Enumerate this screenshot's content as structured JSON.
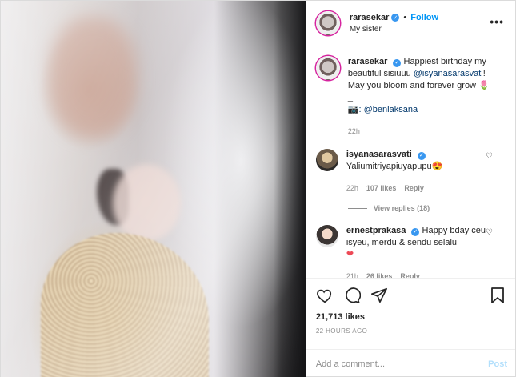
{
  "header": {
    "username": "rarasekar",
    "separator": "•",
    "follow_label": "Follow",
    "location": "My sister",
    "more_label": "•••"
  },
  "caption": {
    "username": "rarasekar",
    "text_before": "Happiest birthday my beautiful sisiuuu ",
    "mention": "@isyanasarasvati",
    "text_after": "! May you bloom and forever grow 🌷",
    "dash": "_",
    "camera": "📷",
    "credit": ": @benlaksana",
    "time": "22h"
  },
  "comments": [
    {
      "username": "isyanasarasvati",
      "text": "Yaliumitriyapiuyapupu😍",
      "time": "22h",
      "likes": "107 likes",
      "reply": "Reply",
      "view_replies": "View replies (18)"
    },
    {
      "username": "ernestprakasa",
      "text": "Happy bday ceu isyeu, merdu & sendu selalu",
      "heart": "❤",
      "time": "21h",
      "likes": "26 likes",
      "reply": "Reply"
    }
  ],
  "actions": {
    "likes": "21,713 likes",
    "time_ago": "22 HOURS AGO"
  },
  "add_comment": {
    "placeholder": "Add a comment...",
    "post_label": "Post"
  },
  "colors": {
    "accent": "#0095f6",
    "verified": "#3897f0",
    "muted": "#8e8e8e",
    "post_disabled": "#b2dffc"
  }
}
